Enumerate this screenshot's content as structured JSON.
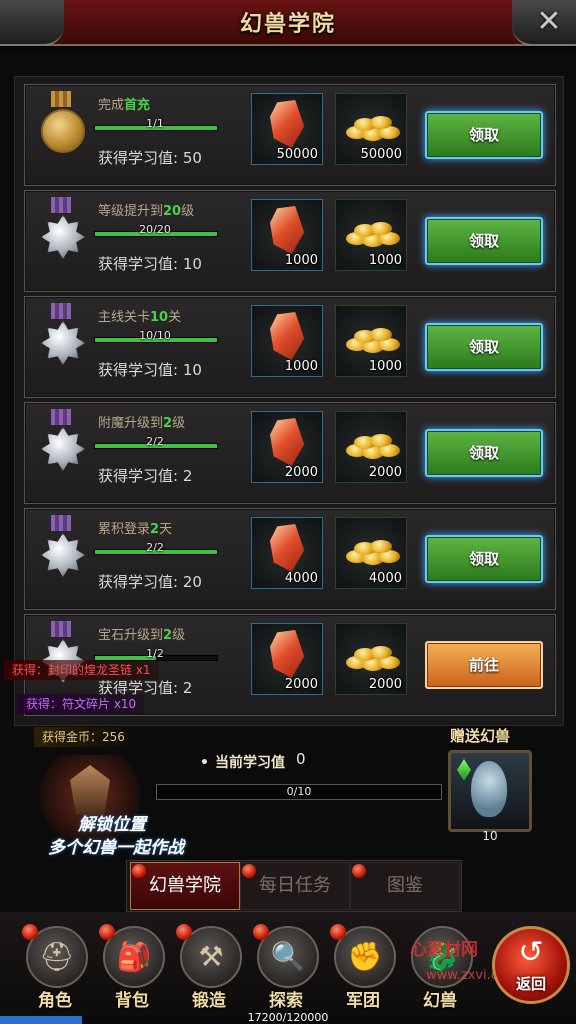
{
  "header": {
    "title": "幻兽学院",
    "close_icon": "close-x-icon"
  },
  "tasks": [
    {
      "name_prefix": "完成",
      "name_highlight": "首充",
      "name_suffix": "",
      "progress_text": "1/1",
      "progress": 1.0,
      "learn_label": "获得学习值: 50",
      "medal": "gold",
      "reward1_count": "50000",
      "reward2_count": "50000",
      "button_label": "领取",
      "button_type": "claim"
    },
    {
      "name_prefix": "等级提升到",
      "name_highlight": "20",
      "name_suffix": "级",
      "progress_text": "20/20",
      "progress": 1.0,
      "learn_label": "获得学习值: 10",
      "medal": "silver",
      "reward1_count": "1000",
      "reward2_count": "1000",
      "button_label": "领取",
      "button_type": "claim"
    },
    {
      "name_prefix": "主线关卡",
      "name_highlight": "10",
      "name_suffix": "关",
      "progress_text": "10/10",
      "progress": 1.0,
      "learn_label": "获得学习值: 10",
      "medal": "silver",
      "reward1_count": "1000",
      "reward2_count": "1000",
      "button_label": "领取",
      "button_type": "claim"
    },
    {
      "name_prefix": "附魔升级到",
      "name_highlight": "2",
      "name_suffix": "级",
      "progress_text": "2/2",
      "progress": 1.0,
      "learn_label": "获得学习值: 2",
      "medal": "silver",
      "reward1_count": "2000",
      "reward2_count": "2000",
      "button_label": "领取",
      "button_type": "claim"
    },
    {
      "name_prefix": "累积登录",
      "name_highlight": "2",
      "name_suffix": "天",
      "progress_text": "2/2",
      "progress": 1.0,
      "learn_label": "获得学习值: 20",
      "medal": "silver",
      "reward1_count": "4000",
      "reward2_count": "4000",
      "button_label": "领取",
      "button_type": "claim"
    },
    {
      "name_prefix": "宝石升级到",
      "name_highlight": "2",
      "name_suffix": "级",
      "progress_text": "1/2",
      "progress": 0.5,
      "learn_label": "获得学习值: 2",
      "medal": "silver",
      "reward1_count": "2000",
      "reward2_count": "2000",
      "button_label": "前往",
      "button_type": "go"
    }
  ],
  "notifications": [
    "获得：封印的煌龙圣链 x1",
    "获得：符文碎片 x10",
    "获得金币：256"
  ],
  "academy": {
    "unlock_line1": "解锁位置",
    "unlock_line2": "多个幻兽一起作战",
    "current_label": "当前学习值",
    "current_value": "0",
    "bar_text": "0/10",
    "bar_progress": 0.0,
    "gift_title": "赠送幻兽",
    "gift_count": "10"
  },
  "tabs": [
    {
      "label": "幻兽学院",
      "active": true
    },
    {
      "label": "每日任务",
      "active": false
    },
    {
      "label": "图鉴",
      "active": false
    }
  ],
  "nav": [
    {
      "label": "角色",
      "icon": "helmet-icon",
      "glyph": "⛑"
    },
    {
      "label": "背包",
      "icon": "backpack-icon",
      "glyph": "🎒"
    },
    {
      "label": "锻造",
      "icon": "hammer-icon",
      "glyph": "⚒"
    },
    {
      "label": "探索",
      "icon": "magnifier-icon",
      "glyph": "🔍"
    },
    {
      "label": "军团",
      "icon": "gauntlet-icon",
      "glyph": "✊"
    },
    {
      "label": "幻兽",
      "icon": "beast-icon",
      "glyph": "🐉"
    }
  ],
  "return_button": {
    "label": "返回"
  },
  "watermark": {
    "line1": "心素材网",
    "line2": "www.zxvi.com"
  },
  "xp": {
    "text": "17200/120000",
    "progress": 0.143
  },
  "colors": {
    "accent_green": "#4ad34a",
    "claim_button": "#5fb543",
    "go_button": "#f6b055",
    "title": "#f2d9a0"
  }
}
